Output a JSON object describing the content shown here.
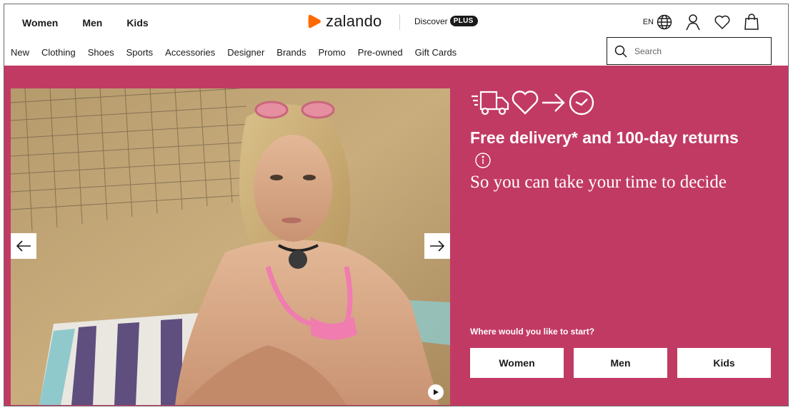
{
  "header": {
    "gender_nav": [
      "Women",
      "Men",
      "Kids"
    ],
    "logo_text": "zalando",
    "discover_label": "Discover",
    "plus_badge": "PLUS",
    "language": "EN",
    "icons": [
      "globe-icon",
      "user-icon",
      "heart-icon",
      "bag-icon"
    ]
  },
  "category_nav": [
    "New",
    "Clothing",
    "Shoes",
    "Sports",
    "Accessories",
    "Designer",
    "Brands",
    "Promo",
    "Pre-owned",
    "Gift Cards"
  ],
  "search": {
    "placeholder": "Search"
  },
  "hero": {
    "title": "Free delivery* and 100-day returns",
    "subtitle": "So you can take your time to decide",
    "start_label": "Where would you like to start?",
    "start_buttons": [
      "Women",
      "Men",
      "Kids"
    ],
    "promo_icons": [
      "delivery-truck-icon",
      "heart-icon",
      "arrow-right-icon",
      "clock-icon"
    ],
    "colors": {
      "background": "#c13a64",
      "text": "#ffffff"
    }
  },
  "brand_colors": {
    "logo_orange": "#ff6900",
    "text": "#1a1a1a"
  }
}
